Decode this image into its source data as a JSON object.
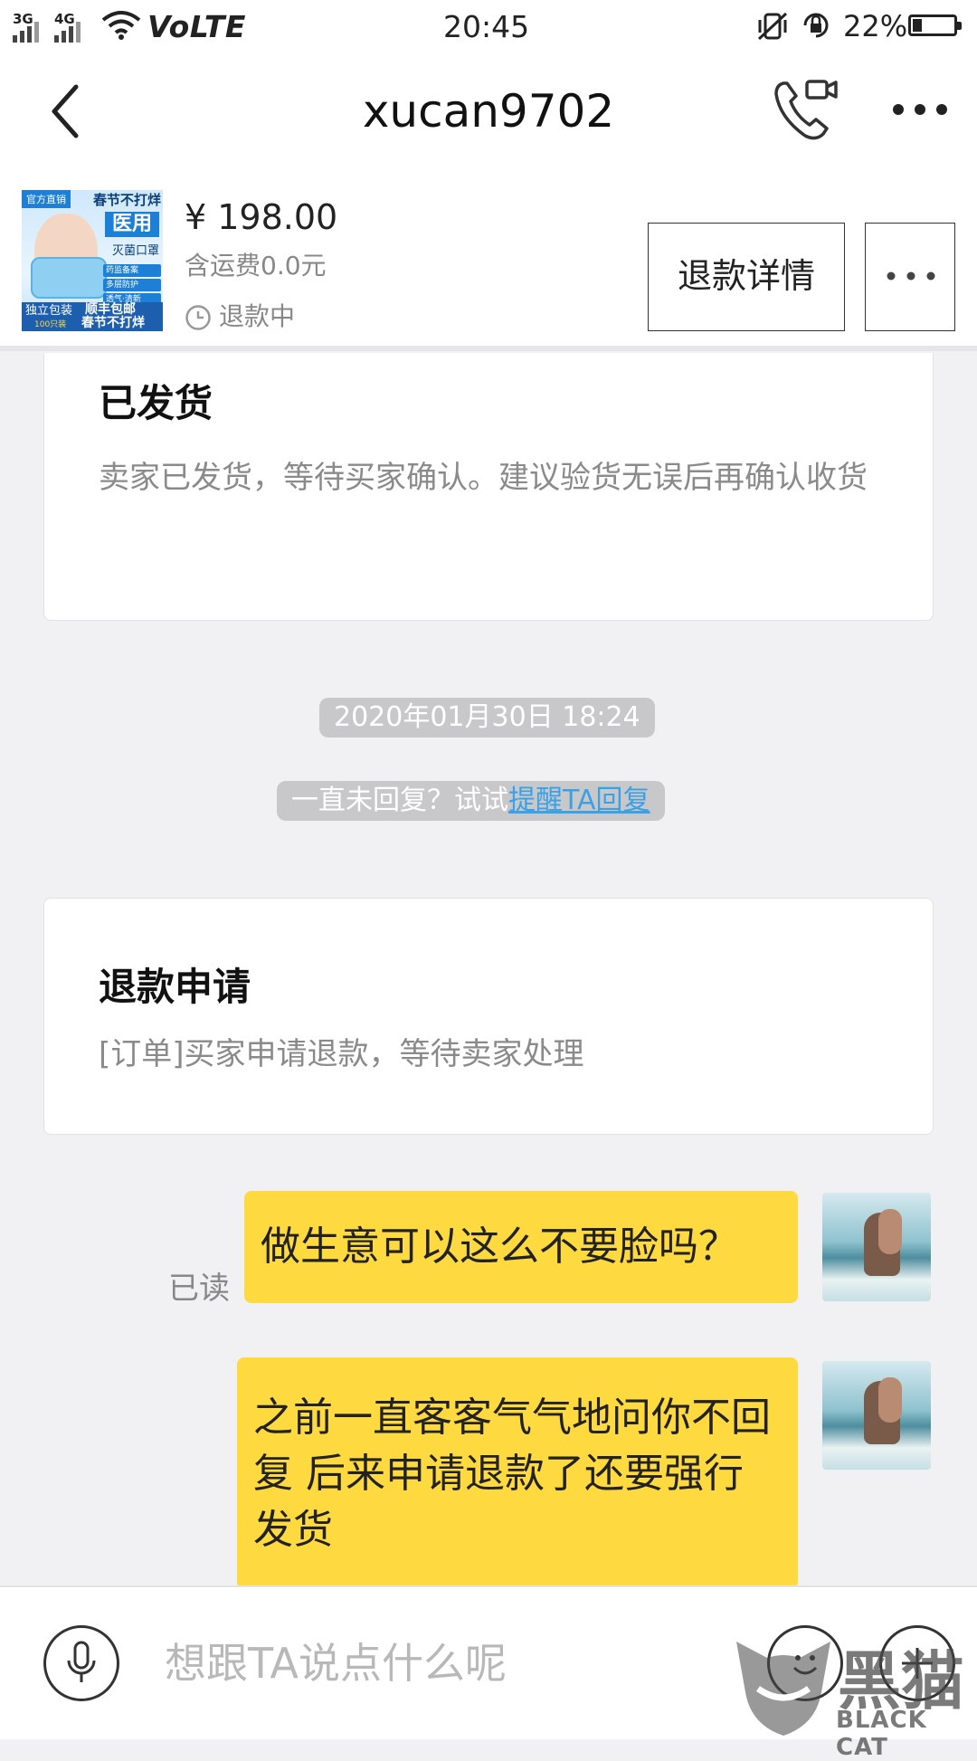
{
  "status_bar": {
    "sim1_network": "3G",
    "sim2_network": "4G",
    "volte": "VoLTE",
    "time": "20:45",
    "battery_percent": "22%",
    "battery_level": 0.22,
    "icons": [
      "signal-icon",
      "wifi-icon",
      "vibrate-icon",
      "rotation-lock-icon",
      "battery-icon"
    ]
  },
  "header": {
    "title": "xucan9702",
    "back_icon": "chevron-left-icon",
    "call_icon": "phone-video-icon",
    "more_icon": "more-dots-icon"
  },
  "product": {
    "thumb_texts": {
      "top_left": "官方直销",
      "top_right": "春节不打烊",
      "big": "医用",
      "sub": "灭菌口罩",
      "chips": [
        "药监备案",
        "多层防护",
        "透气·清新"
      ],
      "foot_left": "独立包装",
      "foot_left_small": "100只装",
      "foot_right_1": "顺丰包邮",
      "foot_right_2": "春节不打烊"
    },
    "price": "¥ 198.00",
    "shipping": "含运费0.0元",
    "status": "退款中",
    "refund_detail_button": "退款详情",
    "more_icon": "more-dots-icon"
  },
  "messages": {
    "card_shipped": {
      "title": "已发货",
      "desc": "卖家已发货，等待买家确认。建议验货无误后再确认收货"
    },
    "timestamp": "2020年01月30日 18:24",
    "remind_prefix": "一直未回复？试试",
    "remind_link": "提醒TA回复",
    "card_refund": {
      "title": "退款申请",
      "desc": "[订单]买家申请退款，等待卖家处理"
    },
    "read_label": "已读",
    "chat": [
      {
        "text": "做生意可以这么不要脸吗？"
      },
      {
        "text": "之前一直客客气气地问你不回复 后来申请退款了还要强行发货"
      }
    ]
  },
  "input_bar": {
    "placeholder": "想跟TA说点什么呢",
    "mic_icon": "microphone-icon",
    "emoji_icon": "emoji-icon",
    "plus_icon": "plus-icon"
  },
  "watermark": {
    "text_cn": "黑猫",
    "text_en": "BLACK CAT"
  }
}
